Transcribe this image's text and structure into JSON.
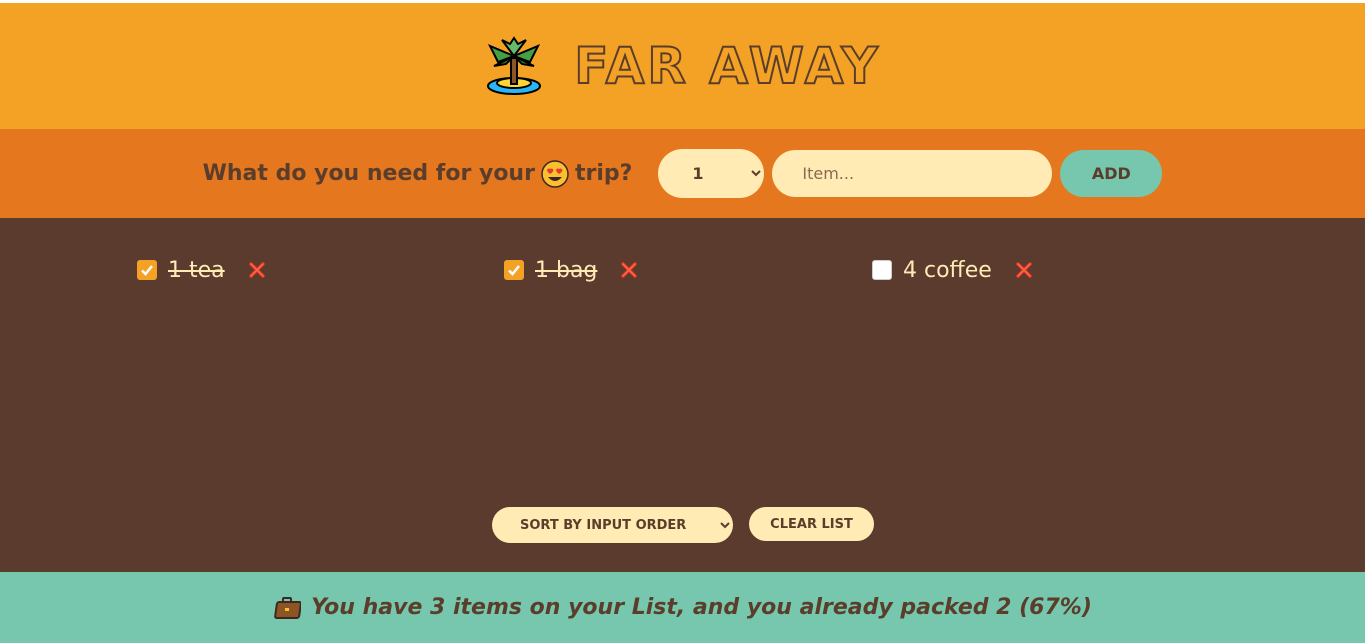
{
  "header": {
    "title": "Far Away",
    "logo_icon": "palm-island-icon"
  },
  "form": {
    "prompt_before": "What do you need for your",
    "prompt_after": "trip?",
    "prompt_emoji": "heart-eyes-emoji",
    "quantity": "1",
    "item_placeholder": "Item...",
    "add_label": "ADD"
  },
  "items": [
    {
      "label": "1 tea",
      "packed": true
    },
    {
      "label": "1 bag",
      "packed": true
    },
    {
      "label": "4 coffee",
      "packed": false
    }
  ],
  "actions": {
    "sort_value": "SORT BY INPUT ORDER",
    "clear_label": "CLEAR LIST"
  },
  "footer": {
    "icon": "briefcase-icon",
    "text": "You have 3 items on your List, and you already packed 2 (67%)"
  },
  "colors": {
    "header_bg": "#f4a226",
    "form_bg": "#e5771f",
    "list_bg": "#5a3b2e",
    "footer_bg": "#76c7ad",
    "cream": "#ffebb3",
    "text_brown": "#5a3e2b",
    "delete_red": "#e5381f"
  }
}
